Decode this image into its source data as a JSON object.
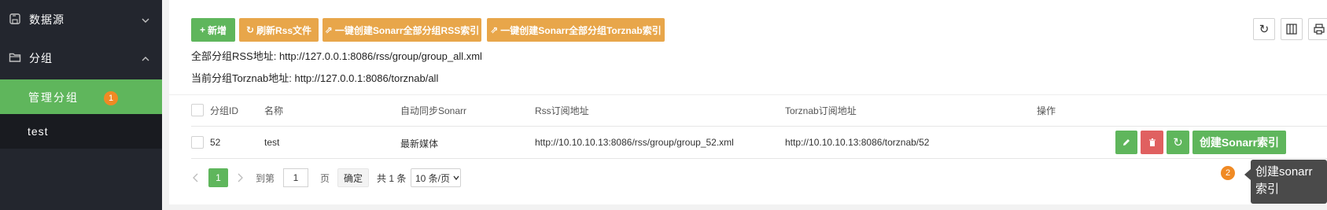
{
  "sidebar": {
    "datasource_label": "数据源",
    "group_label": "分组",
    "manage_group_label": "管理分组",
    "manage_group_badge": "1",
    "test_label": "test"
  },
  "toolbar": {
    "add_label": "新增",
    "refresh_rss_label": "刷新Rss文件",
    "create_rss_label": "一键创建Sonarr全部分组RSS索引",
    "create_torznab_label": "一键创建Sonarr全部分组Torznab索引"
  },
  "info": {
    "rss_line": "全部分组RSS地址: http://127.0.0.1:8086/rss/group/group_all.xml",
    "torznab_line": "当前分组Torznab地址: http://127.0.0.1:8086/torznab/all"
  },
  "table": {
    "headers": [
      "分组ID",
      "名称",
      "自动同步Sonarr",
      "Rss订阅地址",
      "Torznab订阅地址",
      "操作"
    ],
    "rows": [
      {
        "id": "52",
        "name": "test",
        "sync": "最新媒体",
        "rss": "http://10.10.10.13:8086/rss/group/group_52.xml",
        "torznab": "http://10.10.10.13:8086/torznab/52",
        "create_label": "创建Sonarr索引"
      }
    ]
  },
  "pagination": {
    "current_page": "1",
    "goto_label": "到第",
    "input_value": "1",
    "page_label": "页",
    "confirm_label": "确定",
    "total_label": "共 1 条",
    "page_size": "10 条/页"
  },
  "tooltip": {
    "badge": "2",
    "text_line1": "创建sonarr",
    "text_line2": "索引"
  },
  "colors": {
    "accent_green": "#5fb65c",
    "accent_orange": "#e8a64a",
    "danger_red": "#e06060",
    "sidebar_bg": "#23262e"
  }
}
